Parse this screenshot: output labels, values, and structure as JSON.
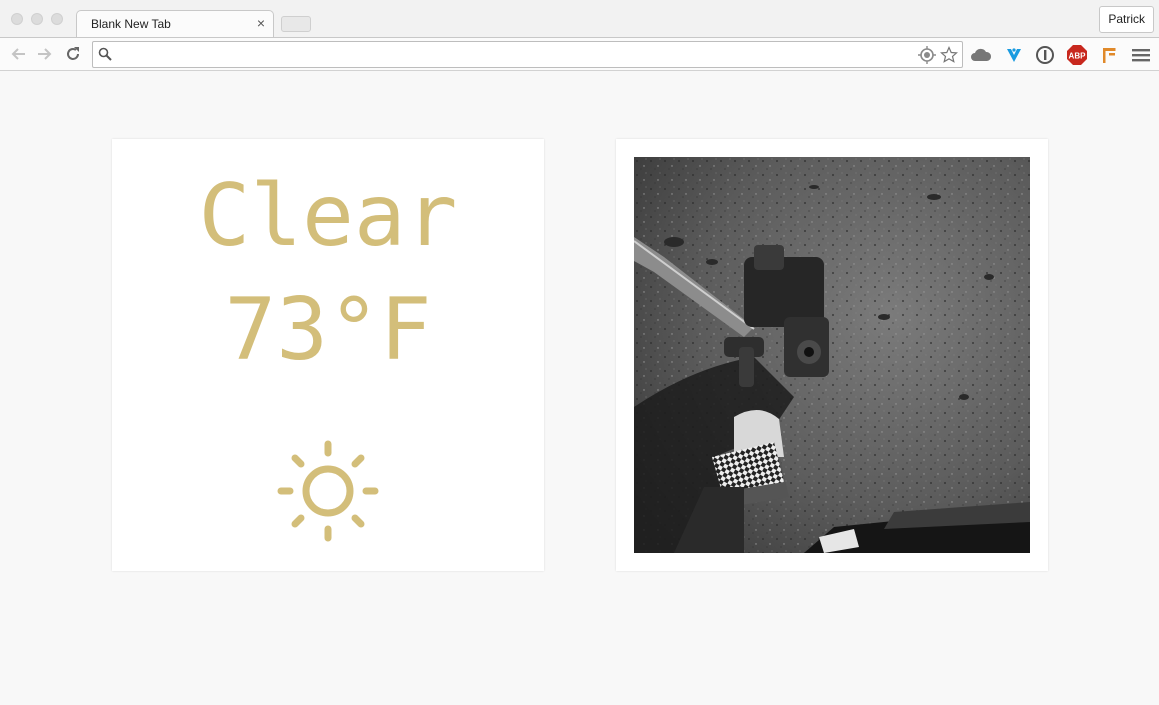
{
  "window": {
    "tab_title": "Blank New Tab",
    "tab_close": "×",
    "profile_name": "Patrick"
  },
  "omnibox": {
    "value": "",
    "placeholder": ""
  },
  "toolbar_icons": [
    "back-icon",
    "forward-icon",
    "reload-icon",
    "search-icon",
    "location-icon",
    "star-icon",
    "cloud-icon",
    "v-extension-icon",
    "onepassword-icon",
    "adblock-icon",
    "flag-extension-icon",
    "menu-icon"
  ],
  "extensions": {
    "adblock_label": "ABP"
  },
  "weather": {
    "condition": "Clear",
    "temperature": "73°F",
    "icon": "sun-icon",
    "color": "#d3be7a"
  },
  "photo": {
    "icon": "mars-rover-photo"
  }
}
